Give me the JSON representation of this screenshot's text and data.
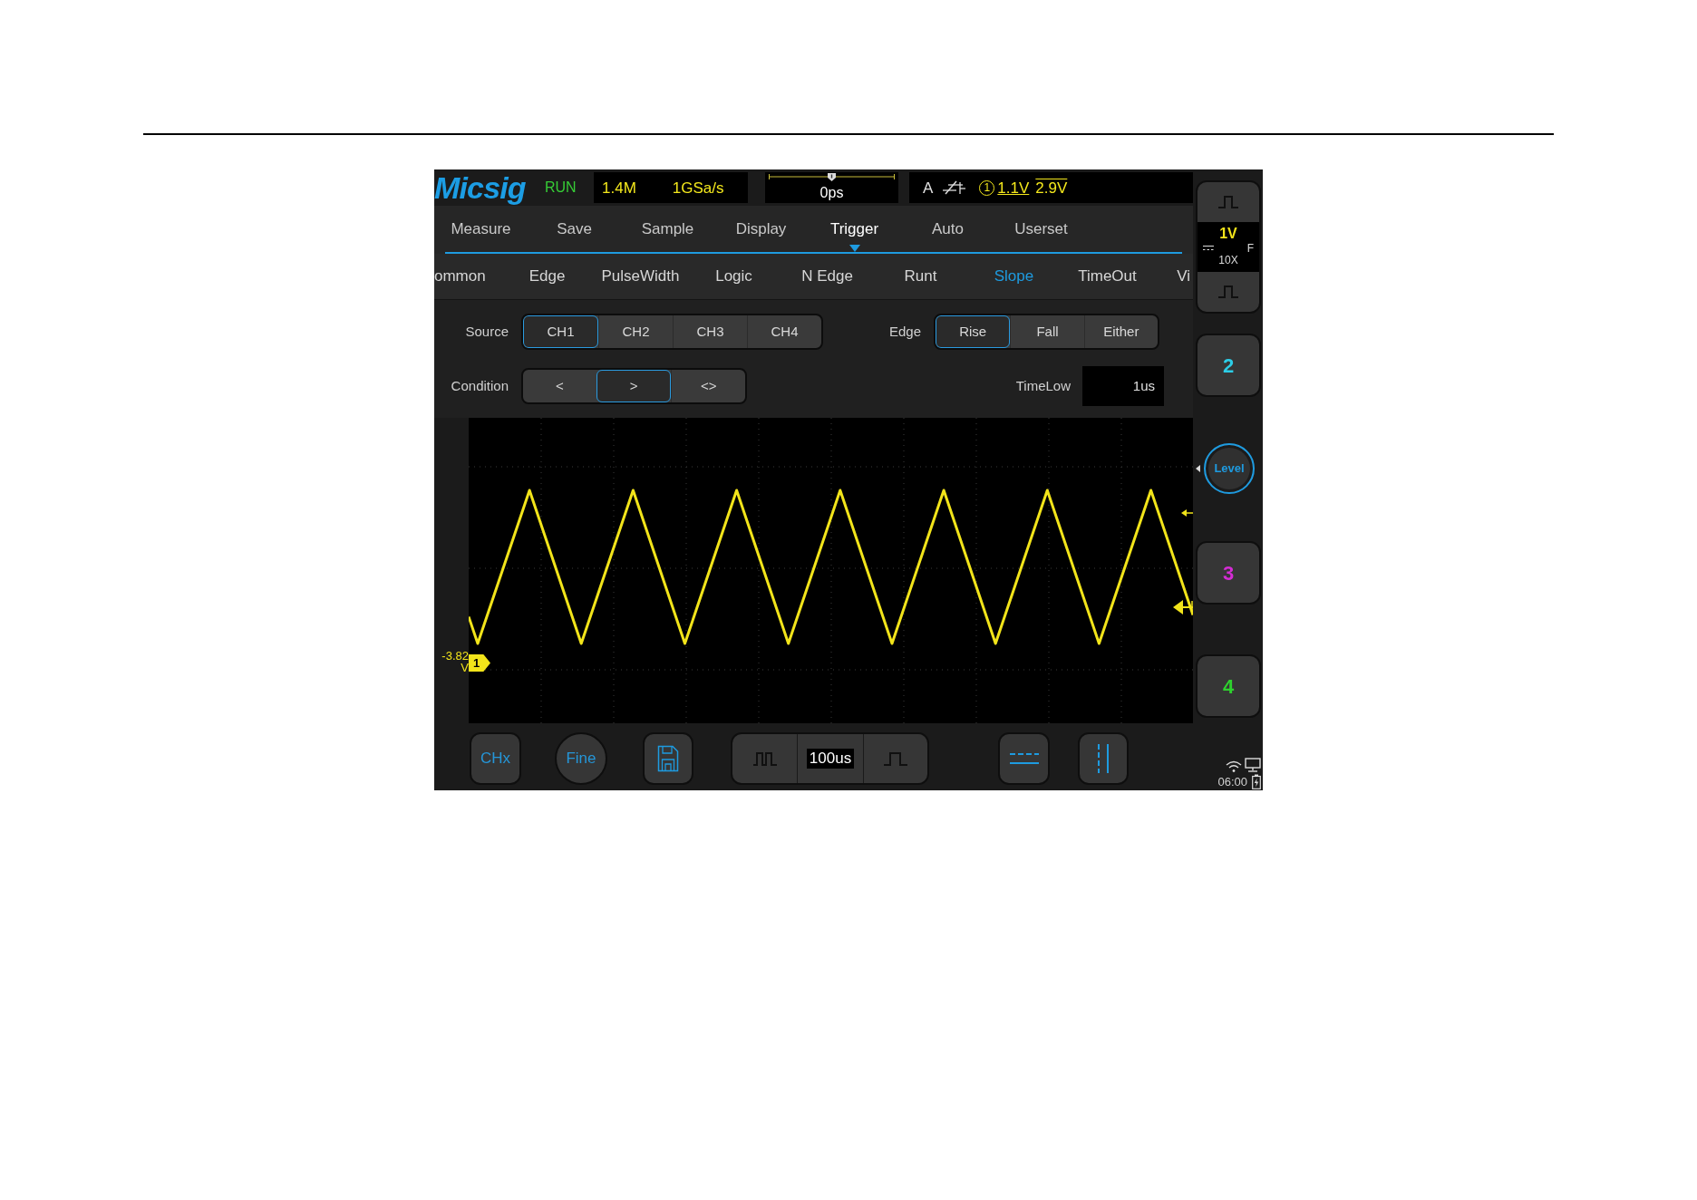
{
  "top_bar": {
    "logo": "Micsig",
    "run_state": "RUN",
    "memory_depth": "1.4M",
    "sample_rate": "1GSa/s",
    "time_offset": "0ps",
    "trigger": {
      "type": "A",
      "source": "1",
      "low_level": "1.1V",
      "high_level": "2.9V"
    }
  },
  "menu": {
    "tabs": [
      {
        "label": "Measure",
        "selected": false
      },
      {
        "label": "Save",
        "selected": false
      },
      {
        "label": "Sample",
        "selected": false
      },
      {
        "label": "Display",
        "selected": false
      },
      {
        "label": "Trigger",
        "selected": true
      },
      {
        "label": "Auto",
        "selected": false
      },
      {
        "label": "Userset",
        "selected": false
      }
    ]
  },
  "trigger_types": [
    {
      "label": "ommon",
      "selected": false
    },
    {
      "label": "Edge",
      "selected": false
    },
    {
      "label": "PulseWidth",
      "selected": false
    },
    {
      "label": "Logic",
      "selected": false
    },
    {
      "label": "N Edge",
      "selected": false
    },
    {
      "label": "Runt",
      "selected": false
    },
    {
      "label": "Slope",
      "selected": true
    },
    {
      "label": "TimeOut",
      "selected": false
    },
    {
      "label": "Vi",
      "selected": false
    }
  ],
  "trigger_settings": {
    "source": {
      "label": "Source",
      "options": [
        {
          "label": "CH1",
          "selected": true
        },
        {
          "label": "CH2",
          "selected": false
        },
        {
          "label": "CH3",
          "selected": false
        },
        {
          "label": "CH4",
          "selected": false
        }
      ]
    },
    "edge": {
      "label": "Edge",
      "options": [
        {
          "label": "Rise",
          "selected": true
        },
        {
          "label": "Fall",
          "selected": false
        },
        {
          "label": "Either",
          "selected": false
        }
      ]
    },
    "condition": {
      "label": "Condition",
      "options": [
        {
          "label": "<",
          "selected": false
        },
        {
          "label": ">",
          "selected": true
        },
        {
          "label": "<>",
          "selected": false
        }
      ]
    },
    "time_low": {
      "label": "TimeLow",
      "value": "1us"
    }
  },
  "waveform": {
    "channel_marker": "1",
    "offset": "-3.82 V"
  },
  "bottom_bar": {
    "channel_button": "CHx",
    "fine_button": "Fine",
    "timebase": "100us"
  },
  "side_panel": {
    "items": [
      {
        "kind": "channel_expanded",
        "color": "#f2e41a",
        "scale": "1V",
        "bandwidth": "F",
        "probe": "10X"
      },
      {
        "kind": "channel",
        "label": "2",
        "color": "#2ccde6"
      },
      {
        "kind": "level",
        "label": "Level"
      },
      {
        "kind": "channel",
        "label": "3",
        "color": "#d42cd4"
      },
      {
        "kind": "channel",
        "label": "4",
        "color": "#2ed12e"
      }
    ],
    "time": "06:00"
  }
}
